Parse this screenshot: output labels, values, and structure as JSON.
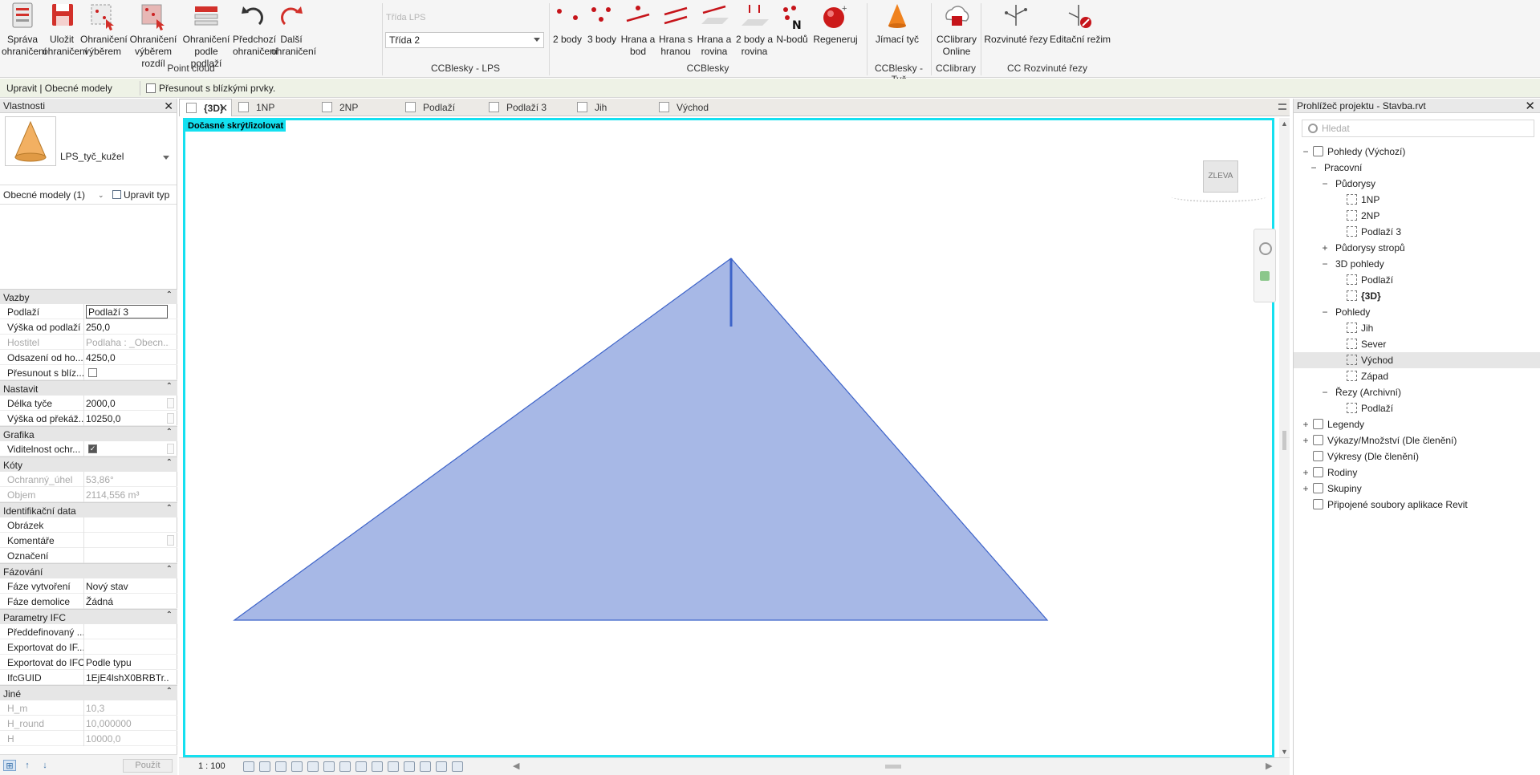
{
  "ribbon": {
    "buttons": [
      {
        "label": "Správa\nohraničení",
        "icon": "manage-bounds-icon"
      },
      {
        "label": "Uložit\nohraničení",
        "icon": "save-icon"
      },
      {
        "label": "Ohraničení\nvýběrem",
        "icon": "select-bounds-icon"
      },
      {
        "label": "Ohraničení\nvýběrem rozdíl",
        "icon": "select-diff-icon"
      },
      {
        "label": "Ohraničení\npodle podlaží",
        "icon": "level-bounds-icon"
      },
      {
        "label": "Předchozí\nohraničení",
        "icon": "undo-icon"
      },
      {
        "label": "Další\nohraničení",
        "icon": "redo-icon"
      }
    ],
    "class_label": "Třída LPS",
    "class_value": "Třída 2",
    "ccb_buttons": [
      "2 body",
      "3 body",
      "Hrana a\nbod",
      "Hrana s\nhranou",
      "Hrana a\nrovina",
      "2 body a\nrovina",
      "N-bodů",
      "Regeneruj"
    ],
    "rod_button": "Jímací tyč",
    "cclib_button": "CClibrary\nOnline",
    "sections_buttons": [
      "Rozvinuté řezy",
      "Editační režim"
    ],
    "panels": [
      "Point cloud",
      "CCBlesky - LPS",
      "CCBlesky",
      "CCBlesky - Tyč",
      "CClibrary",
      "CC Rozvinuté řezy"
    ]
  },
  "context": {
    "title": "Upravit | Obecné modely",
    "move_label": "Přesunout s blízkými prvky."
  },
  "properties": {
    "title": "Vlastnosti",
    "type_name": "LPS_tyč_kužel",
    "instance_label": "Obecné modely (1)",
    "edit_type": "Upravit typ",
    "apply": "Použít",
    "groups": [
      {
        "name": "Vazby",
        "rows": [
          {
            "name": "Podlaží",
            "value": "Podlaží 3",
            "edit": true
          },
          {
            "name": "Výška od podlaží",
            "value": "250,0"
          },
          {
            "name": "Hostitel",
            "value": "Podlaha : _Obecn...",
            "disabled": true
          },
          {
            "name": "Odsazení od ho...",
            "value": "4250,0"
          },
          {
            "name": "Přesunout s blíz...",
            "value": "",
            "checkbox": false
          }
        ]
      },
      {
        "name": "Nastavit",
        "rows": [
          {
            "name": "Délka tyče",
            "value": "2000,0",
            "btn": true
          },
          {
            "name": "Výška od překáž...",
            "value": "10250,0",
            "btn": true
          }
        ]
      },
      {
        "name": "Grafika",
        "rows": [
          {
            "name": "Viditelnost ochr...",
            "value": "",
            "checkbox": true,
            "btn": true
          }
        ]
      },
      {
        "name": "Kóty",
        "rows": [
          {
            "name": "Ochranný_úhel",
            "value": "53,86°",
            "disabled": true
          },
          {
            "name": "Objem",
            "value": "2114,556 m³",
            "disabled": true
          }
        ]
      },
      {
        "name": "Identifikační data",
        "rows": [
          {
            "name": "Obrázek",
            "value": ""
          },
          {
            "name": "Komentáře",
            "value": "",
            "btn": true
          },
          {
            "name": "Označení",
            "value": ""
          }
        ]
      },
      {
        "name": "Fázování",
        "rows": [
          {
            "name": "Fáze vytvoření",
            "value": "Nový stav"
          },
          {
            "name": "Fáze demolice",
            "value": "Žádná"
          }
        ]
      },
      {
        "name": "Parametry IFC",
        "rows": [
          {
            "name": "Předdefinovaný ...",
            "value": ""
          },
          {
            "name": "Exportovat do IF...",
            "value": ""
          },
          {
            "name": "Exportovat do IFC",
            "value": "Podle typu"
          },
          {
            "name": "IfcGUID",
            "value": "1EjE4lshX0BRBTr..."
          }
        ]
      },
      {
        "name": "Jiné",
        "rows": [
          {
            "name": "H_m",
            "value": "10,3",
            "disabled": true
          },
          {
            "name": "H_round",
            "value": "10,000000",
            "disabled": true
          },
          {
            "name": "H",
            "value": "10000,0",
            "disabled": true
          }
        ]
      }
    ]
  },
  "tabs": [
    "{3D}",
    "1NP",
    "2NP",
    "Podlaží",
    "Podlaží 3",
    "Jih",
    "Východ"
  ],
  "canvas": {
    "badge": "Dočasné skrýt/izolovat",
    "viewcube": "ZLEVA",
    "scale": "1 : 100",
    "colors": {
      "cone_fill": "#a7b8e6",
      "cone_edge": "#3d63c9",
      "isolate": "#14e0f0"
    }
  },
  "browser": {
    "title": "Prohlížeč projektu - Stavba.rvt",
    "search_placeholder": "Hledat",
    "tree": [
      {
        "label": "Pohledy (Výchozí)",
        "lvl": 0,
        "exp": "−",
        "icon": "views"
      },
      {
        "label": "Pracovní",
        "lvl": 1,
        "exp": "−"
      },
      {
        "label": "Půdorysy",
        "lvl": 2,
        "exp": "−"
      },
      {
        "label": "1NP",
        "lvl": 3,
        "view": true
      },
      {
        "label": "2NP",
        "lvl": 3,
        "view": true
      },
      {
        "label": "Podlaží 3",
        "lvl": 3,
        "view": true
      },
      {
        "label": "Půdorysy stropů",
        "lvl": 2,
        "exp": "+"
      },
      {
        "label": "3D pohledy",
        "lvl": 2,
        "exp": "−"
      },
      {
        "label": "Podlaží",
        "lvl": 3,
        "view": true
      },
      {
        "label": "{3D}",
        "lvl": 3,
        "view": true,
        "bold": true
      },
      {
        "label": "Pohledy",
        "lvl": 2,
        "exp": "−"
      },
      {
        "label": "Jih",
        "lvl": 3,
        "view": true
      },
      {
        "label": "Sever",
        "lvl": 3,
        "view": true
      },
      {
        "label": "Východ",
        "lvl": 3,
        "view": true,
        "selected": true
      },
      {
        "label": "Západ",
        "lvl": 3,
        "view": true
      },
      {
        "label": "Řezy (Archivní)",
        "lvl": 2,
        "exp": "−"
      },
      {
        "label": "Podlaží",
        "lvl": 3,
        "view": true
      },
      {
        "label": "Legendy",
        "lvl": 0,
        "exp": "+",
        "icon": "legend"
      },
      {
        "label": "Výkazy/Množství (Dle členění)",
        "lvl": 0,
        "exp": "+",
        "icon": "schedule"
      },
      {
        "label": "Výkresy (Dle členění)",
        "lvl": 0,
        "icon": "sheet"
      },
      {
        "label": "Rodiny",
        "lvl": 0,
        "exp": "+",
        "icon": "family"
      },
      {
        "label": "Skupiny",
        "lvl": 0,
        "exp": "+",
        "icon": "group"
      },
      {
        "label": "Připojené soubory aplikace Revit",
        "lvl": 0,
        "icon": "link"
      }
    ]
  }
}
